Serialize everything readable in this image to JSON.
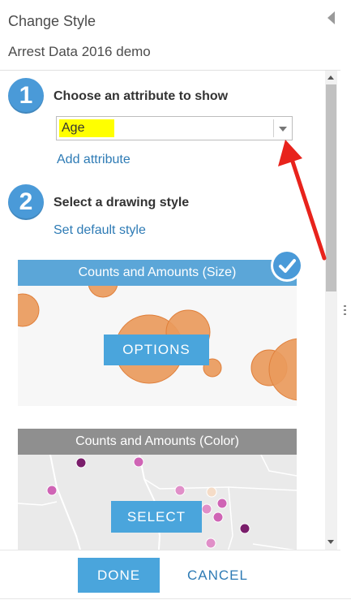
{
  "header": {
    "title": "Change Style",
    "layer_name": "Arrest Data 2016 demo"
  },
  "step1": {
    "number": "1",
    "label": "Choose an attribute to show",
    "selected_attribute": "Age",
    "add_attribute_link": "Add attribute"
  },
  "step2": {
    "number": "2",
    "label": "Select a drawing style",
    "default_style_link": "Set default style"
  },
  "styles": [
    {
      "title": "Counts and Amounts (Size)",
      "button": "OPTIONS",
      "selected": true,
      "header_color": "#5ba6d8"
    },
    {
      "title": "Counts and Amounts (Color)",
      "button": "SELECT",
      "selected": false,
      "header_color": "#8f8f8f"
    }
  ],
  "footer": {
    "done_label": "DONE",
    "cancel_label": "CANCEL"
  },
  "colors": {
    "accent": "#4a9ad8",
    "link": "#2e7bb5",
    "highlight": "#ffff00",
    "annotation_arrow": "#e8231c",
    "size_symbol": "#e99a5c"
  }
}
